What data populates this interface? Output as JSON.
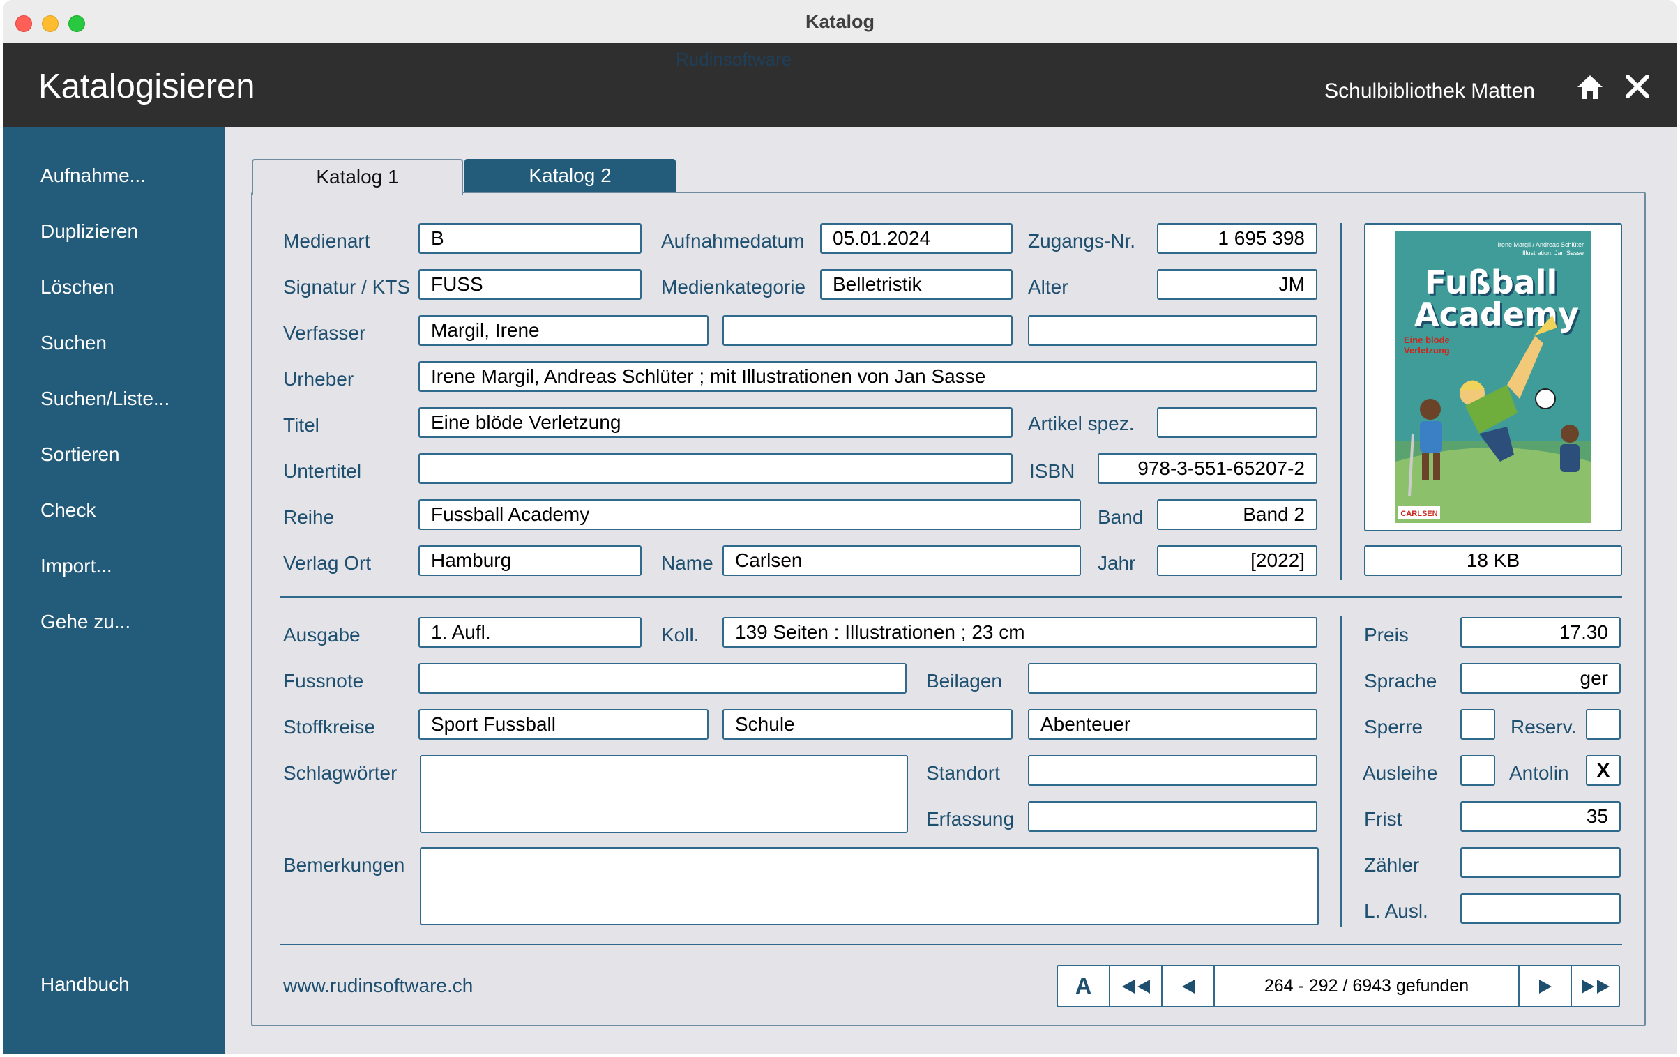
{
  "window": {
    "title": "Katalog"
  },
  "header": {
    "title": "Katalogisieren",
    "faded_text": "Rudinsoftware",
    "library_name": "Schulbibliothek Matten",
    "home_icon": "home-icon",
    "close_icon": "close-icon"
  },
  "sidebar": {
    "items": [
      "Aufnahme...",
      "Duplizieren",
      "Löschen",
      "Suchen",
      "Suchen/Liste...",
      "Sortieren",
      "Check",
      "Import...",
      "Gehe zu..."
    ],
    "footer": "Handbuch"
  },
  "tabs": [
    "Katalog 1",
    "Katalog 2"
  ],
  "form": {
    "medienart": {
      "label": "Medienart",
      "value": "B"
    },
    "aufnahmedatum": {
      "label": "Aufnahmedatum",
      "value": "05.01.2024"
    },
    "zugangs_nr": {
      "label": "Zugangs-Nr.",
      "value": "1 695 398"
    },
    "signatur": {
      "label": "Signatur / KTS",
      "value": "FUSS"
    },
    "medienkategorie": {
      "label": "Medienkategorie",
      "value": "Belletristik"
    },
    "alter": {
      "label": "Alter",
      "value": "JM"
    },
    "verfasser": {
      "label": "Verfasser",
      "values": [
        "Margil, Irene",
        "",
        ""
      ]
    },
    "urheber": {
      "label": "Urheber",
      "value": "Irene Margil, Andreas Schlüter ; mit Illustrationen von Jan Sasse"
    },
    "titel": {
      "label": "Titel",
      "value": "Eine blöde Verletzung"
    },
    "artikel_spez": {
      "label": "Artikel spez.",
      "value": ""
    },
    "untertitel": {
      "label": "Untertitel",
      "value": ""
    },
    "isbn": {
      "label": "ISBN",
      "value": "978-3-551-65207-2"
    },
    "reihe": {
      "label": "Reihe",
      "value": "Fussball Academy"
    },
    "band": {
      "label": "Band",
      "value": "Band 2"
    },
    "verlag_ort": {
      "label": "Verlag Ort",
      "value": "Hamburg"
    },
    "name": {
      "label": "Name",
      "value": "Carlsen"
    },
    "jahr": {
      "label": "Jahr",
      "value": "[2022]"
    },
    "image_size": "18 KB",
    "ausgabe": {
      "label": "Ausgabe",
      "value": "1. Aufl."
    },
    "koll": {
      "label": "Koll.",
      "value": "139 Seiten : Illustrationen ; 23 cm"
    },
    "fussnote": {
      "label": "Fussnote",
      "value": ""
    },
    "beilagen": {
      "label": "Beilagen",
      "value": ""
    },
    "stoffkreise": {
      "label": "Stoffkreise",
      "values": [
        "Sport Fussball",
        "Schule",
        "Abenteuer"
      ]
    },
    "schlagwoerter": {
      "label": "Schlagwörter",
      "value": ""
    },
    "standort": {
      "label": "Standort",
      "value": ""
    },
    "erfassung": {
      "label": "Erfassung",
      "value": ""
    },
    "bemerkungen": {
      "label": "Bemerkungen",
      "value": ""
    },
    "preis": {
      "label": "Preis",
      "value": "17.30"
    },
    "sprache": {
      "label": "Sprache",
      "value": "ger"
    },
    "sperre": {
      "label": "Sperre",
      "value": ""
    },
    "reserv": {
      "label": "Reserv.",
      "value": ""
    },
    "ausleihe": {
      "label": "Ausleihe",
      "value": ""
    },
    "antolin": {
      "label": "Antolin",
      "value": "X"
    },
    "frist": {
      "label": "Frist",
      "value": "35"
    },
    "zaehler": {
      "label": "Zähler",
      "value": ""
    },
    "l_ausl": {
      "label": "L. Ausl.",
      "value": ""
    }
  },
  "cover": {
    "top_line1": "Irene Margil / Andreas Schlüter",
    "top_line2": "Illustration: Jan Sasse",
    "title1": "Fußball",
    "title2": "Academy",
    "subtitle1": "Eine blöde",
    "subtitle2": "Verletzung",
    "publisher": "CARLSEN",
    "colors": {
      "bg": "#3f9c98",
      "title": "#ffffff",
      "title_shadow": "#1d4f6b",
      "publisher": "#c8281e"
    }
  },
  "footer": {
    "website": "www.rudinsoftware.ch",
    "nav": {
      "sort_label": "A",
      "first": "first-icon",
      "prev": "previous-icon",
      "status": "264 - 292 / 6943 gefunden",
      "next": "next-icon",
      "last": "last-icon"
    }
  },
  "colors": {
    "sidebar": "#235b7a",
    "header": "#2f2f2f",
    "label": "#1e4f6f",
    "border": "#2f6a8c"
  }
}
